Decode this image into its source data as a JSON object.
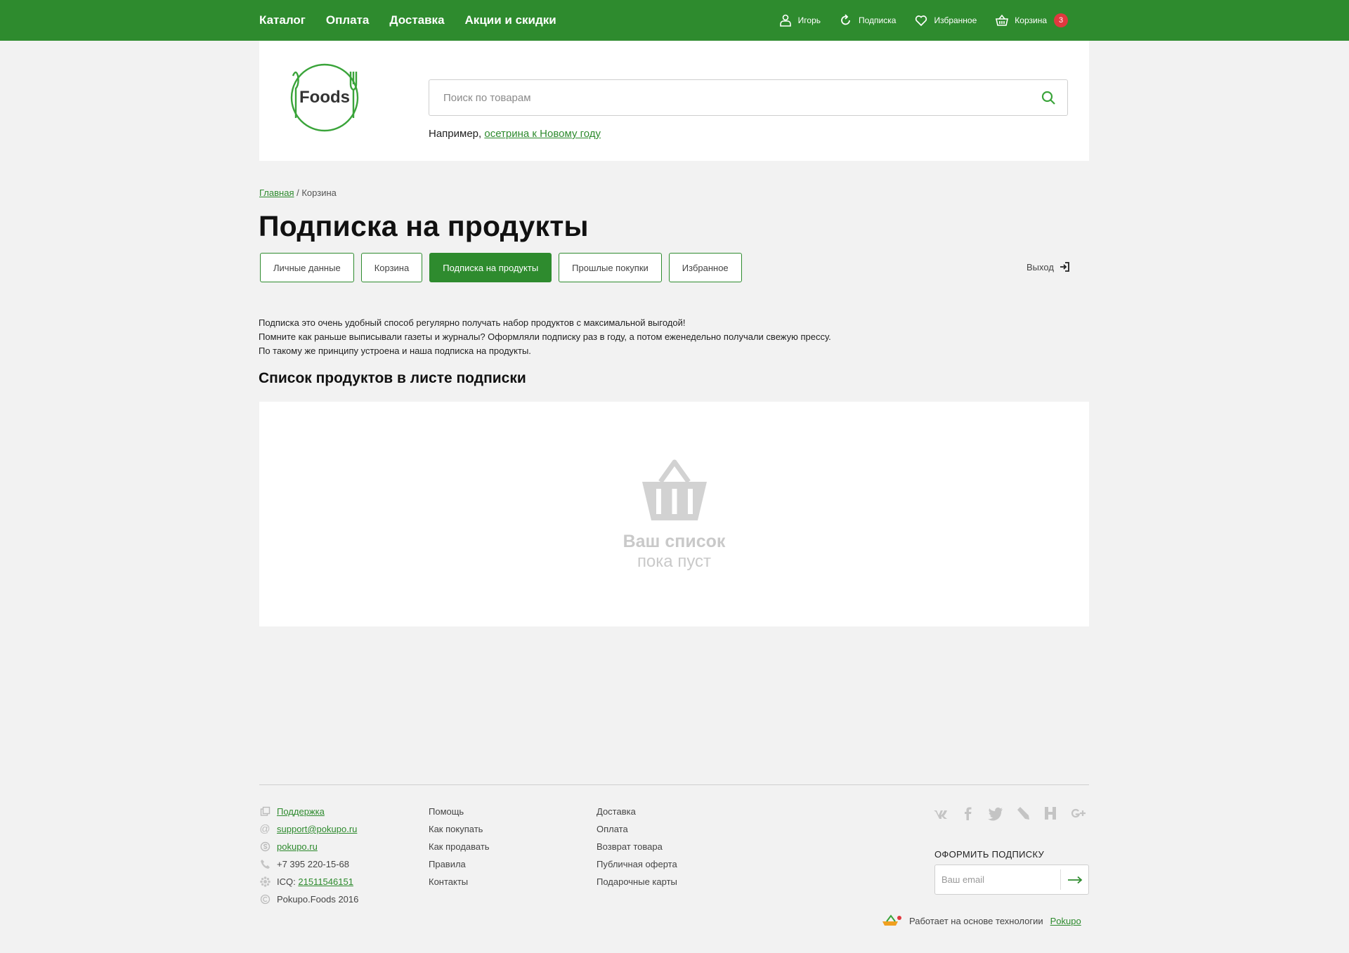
{
  "topbar": {
    "nav": [
      "Каталог",
      "Оплата",
      "Доставка",
      "Акции и скидки"
    ],
    "user_label": "Игорь",
    "subscription_label": "Подписка",
    "favorites_label": "Избранное",
    "cart_label": "Корзина",
    "cart_count": "3"
  },
  "header": {
    "logo_text": "Foods",
    "search_placeholder": "Поиск по товарам",
    "example_prefix": "Например,",
    "example_link": "осетрина к Новому году"
  },
  "breadcrumb": {
    "home": "Главная",
    "separator": "/",
    "current": "Корзина"
  },
  "page_title": "Подписка на продукты",
  "tabs": [
    {
      "label": "Личные данные",
      "active": false
    },
    {
      "label": "Корзина",
      "active": false
    },
    {
      "label": "Подписка на продукты",
      "active": true
    },
    {
      "label": "Прошлые покупки",
      "active": false
    },
    {
      "label": "Избранное",
      "active": false
    }
  ],
  "logout_label": "Выход",
  "description": [
    "Подписка это очень удобный способ регулярно получать набор продуктов с максимальной выгодой!",
    "Помните как раньше выписывали газеты и журналы? Оформляли подписку раз в году, а потом еженедельно получали свежую прессу.",
    "По такому же принципу устроена и наша подписка на продукты."
  ],
  "list_title": "Список продуктов в листе подписки",
  "empty_state": {
    "line1": "Ваш список",
    "line2": "пока пуст"
  },
  "footer": {
    "contacts": {
      "support": "Поддержка",
      "email": "support@pokupo.ru",
      "skype": "pokupo.ru",
      "phone": "+7 395 220-15-68",
      "icq_prefix": "ICQ:",
      "icq": "21511546151",
      "copyright": "Pokupo.Foods 2016"
    },
    "col2": [
      "Помощь",
      "Как покупать",
      "Как продавать",
      "Правила",
      "Контакты"
    ],
    "col3": [
      "Доставка",
      "Оплата",
      "Возврат товара",
      "Публичная оферта",
      "Подарочные карты"
    ],
    "social_icons": [
      "vk-icon",
      "facebook-icon",
      "twitter-icon",
      "livejournal-icon",
      "habr-icon",
      "google-plus-icon"
    ],
    "subscribe_title": "ОФОРМИТЬ ПОДПИСКУ",
    "email_placeholder": "Ваш email",
    "powered_text": "Работает на основе технологии",
    "powered_link": "Pokupo"
  },
  "colors": {
    "brand_green": "#2e8b2e",
    "badge_red": "#e0393f",
    "background": "#f2f2f2"
  }
}
